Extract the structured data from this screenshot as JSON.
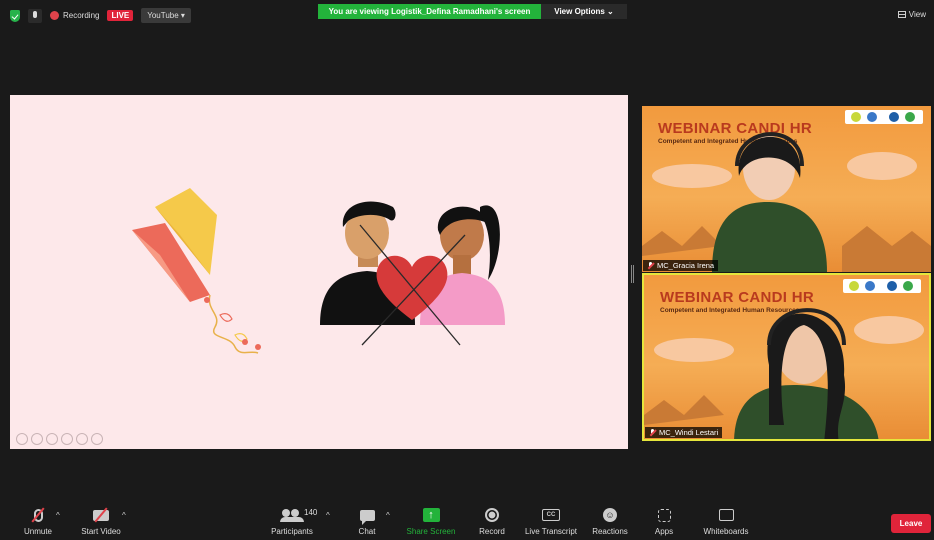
{
  "topbar": {
    "recording_label": "Recording",
    "live_badge": "LIVE",
    "youtube_label": "YouTube ▾",
    "viewing_banner": "You are viewing Logistik_Defina Ramadhani's screen",
    "view_options": "View Options ⌄",
    "view_label": "View"
  },
  "participants": [
    {
      "name": "MC_Gracia Irena",
      "webinar_title": "WEBINAR CANDI HR",
      "subtitle": "Competent and Integrated Human Resources"
    },
    {
      "name": "MC_Windi Lestari",
      "webinar_title": "WEBINAR CANDI HR",
      "subtitle": "Competent and Integrated Human Resources"
    }
  ],
  "toolbar": {
    "unmute": "Unmute",
    "start_video": "Start Video",
    "participants": "Participants",
    "participant_count": "140",
    "chat": "Chat",
    "share_screen": "Share Screen",
    "record": "Record",
    "live_transcript": "Live Transcript",
    "cc_icon_text": "CC",
    "reactions": "Reactions",
    "apps": "Apps",
    "whiteboards": "Whiteboards",
    "leave": "Leave",
    "caret": "^"
  },
  "colors": {
    "zoom_green": "#23b33b",
    "leave_red": "#e0243a",
    "slide_bg": "#fde8ea",
    "heart_red": "#d63a3a"
  }
}
